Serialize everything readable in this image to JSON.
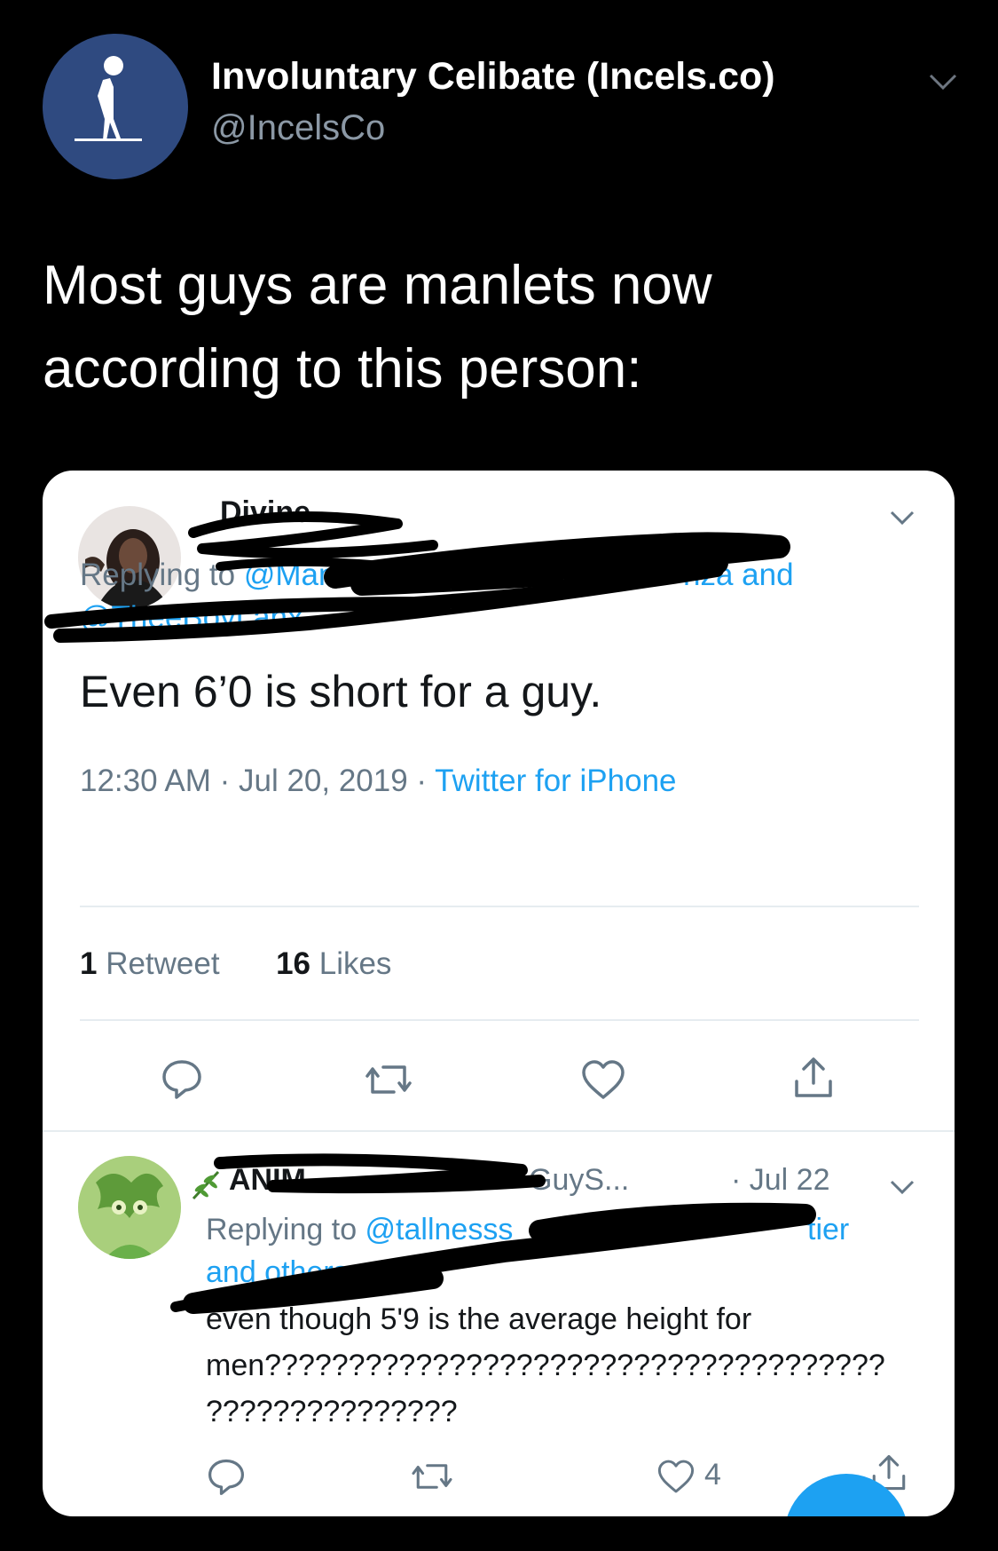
{
  "header": {
    "display_name": "Involuntary Celibate (Incels.co)",
    "handle": "@IncelsCo",
    "tweet_text": "Most guys are manlets now according to this person:"
  },
  "embedded": {
    "main_tweet": {
      "author_name": "Divine",
      "reply_prefix": "Replying to ",
      "reply_handle_start": "@Manii",
      "reply_handle_tail": "nza and",
      "reply_second_line": "@TheeBoyLanx",
      "text": "Even 6’0 is short for a guy.",
      "timestamp": "12:30 AM · Jul 20, 2019 · ",
      "source": "Twitter for iPhone",
      "retweet_count": "1",
      "retweet_label": " Retweet",
      "likes_count": "16",
      "likes_label": " Likes"
    },
    "reply_tweet": {
      "name_fragment": "ANIM",
      "name_tail": "GuyS...",
      "date": "· Jul 22",
      "reply_prefix": "Replying to ",
      "reply_handle": "@tallnesss",
      "reply_tail": "tier",
      "reply_second_line": "and others",
      "text_line1": "even though 5'9 is the average height for",
      "text_line2": "men?????????????????????????????????????",
      "text_line3": "???????????????",
      "like_count": "4"
    }
  },
  "colors": {
    "background": "#000000",
    "card": "#ffffff",
    "accent": "#1da1f2",
    "muted": "#657786",
    "avatar": "#2f4a80"
  },
  "icons": [
    "person-standing-icon",
    "chevron-down-icon",
    "reply-icon",
    "retweet-icon",
    "heart-icon",
    "share-icon",
    "leaf-icon"
  ]
}
